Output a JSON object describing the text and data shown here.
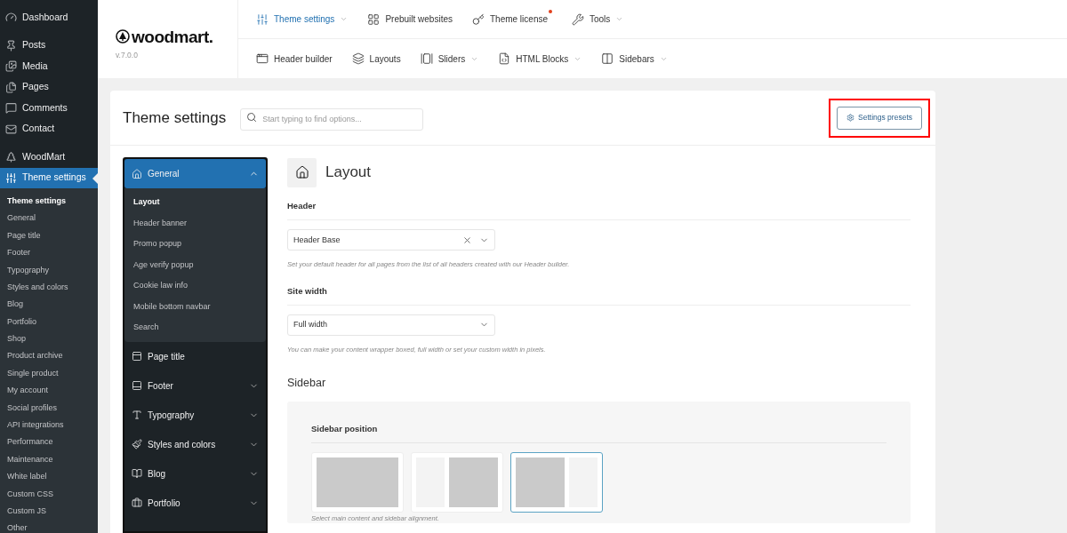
{
  "admin_menu": {
    "groups": [
      [
        {
          "label": "Dashboard",
          "selected": false
        }
      ],
      [
        {
          "label": "Posts",
          "selected": false
        },
        {
          "label": "Media",
          "selected": false
        },
        {
          "label": "Pages",
          "selected": false
        },
        {
          "label": "Comments",
          "selected": false
        },
        {
          "label": "Contact",
          "selected": false
        }
      ],
      [
        {
          "label": "WoodMart",
          "selected": false
        },
        {
          "label": "Theme settings",
          "selected": true
        }
      ]
    ],
    "submenu": [
      {
        "label": "Theme settings",
        "selected": true
      },
      {
        "label": "General",
        "selected": false
      },
      {
        "label": "Page title",
        "selected": false
      },
      {
        "label": "Footer",
        "selected": false
      },
      {
        "label": "Typography",
        "selected": false
      },
      {
        "label": "Styles and colors",
        "selected": false
      },
      {
        "label": "Blog",
        "selected": false
      },
      {
        "label": "Portfolio",
        "selected": false
      },
      {
        "label": "Shop",
        "selected": false
      },
      {
        "label": "Product archive",
        "selected": false
      },
      {
        "label": "Single product",
        "selected": false
      },
      {
        "label": "My account",
        "selected": false
      },
      {
        "label": "Social profiles",
        "selected": false
      },
      {
        "label": "API integrations",
        "selected": false
      },
      {
        "label": "Performance",
        "selected": false
      },
      {
        "label": "Maintenance",
        "selected": false
      },
      {
        "label": "White label",
        "selected": false
      },
      {
        "label": "Custom CSS",
        "selected": false
      },
      {
        "label": "Custom JS",
        "selected": false
      },
      {
        "label": "Other",
        "selected": false
      }
    ]
  },
  "brand": {
    "name": "woodmart.",
    "version": "v.7.0.0"
  },
  "top_nav": [
    [
      {
        "label": "Theme settings",
        "selected": true,
        "has_dropdown": true,
        "notification": false
      },
      {
        "label": "Prebuilt websites",
        "selected": false,
        "has_dropdown": false,
        "notification": false
      },
      {
        "label": "Theme license",
        "selected": false,
        "has_dropdown": false,
        "notification": true
      },
      {
        "label": "Tools",
        "selected": false,
        "has_dropdown": true,
        "notification": false
      }
    ],
    [
      {
        "label": "Header builder",
        "selected": false,
        "has_dropdown": false,
        "notification": false
      },
      {
        "label": "Layouts",
        "selected": false,
        "has_dropdown": false,
        "notification": false
      },
      {
        "label": "Sliders",
        "selected": false,
        "has_dropdown": true,
        "notification": false
      },
      {
        "label": "HTML Blocks",
        "selected": false,
        "has_dropdown": true,
        "notification": false
      },
      {
        "label": "Sidebars",
        "selected": false,
        "has_dropdown": true,
        "notification": false
      }
    ]
  ],
  "page": {
    "title": "Theme settings",
    "search": {
      "placeholder": "Start typing to find options..."
    },
    "presets_button": {
      "label": "Settings presets",
      "highlighted": true
    }
  },
  "sections_nav": [
    {
      "label": "General",
      "expanded": true,
      "expandable": true,
      "children": [
        {
          "label": "Layout",
          "selected": true
        },
        {
          "label": "Header banner",
          "selected": false
        },
        {
          "label": "Promo popup",
          "selected": false
        },
        {
          "label": "Age verify popup",
          "selected": false
        },
        {
          "label": "Cookie law info",
          "selected": false
        },
        {
          "label": "Mobile bottom navbar",
          "selected": false
        },
        {
          "label": "Search",
          "selected": false
        }
      ]
    },
    {
      "label": "Page title",
      "expanded": false,
      "expandable": false
    },
    {
      "label": "Footer",
      "expanded": false,
      "expandable": true
    },
    {
      "label": "Typography",
      "expanded": false,
      "expandable": true
    },
    {
      "label": "Styles and colors",
      "expanded": false,
      "expandable": true
    },
    {
      "label": "Blog",
      "expanded": false,
      "expandable": true
    },
    {
      "label": "Portfolio",
      "expanded": false,
      "expandable": true
    }
  ],
  "content": {
    "title": "Layout",
    "fields": [
      {
        "label": "Header",
        "value": "Header Base",
        "clearable": true,
        "hint": "Set your default header for all pages from the list of all headers created with our Header builder."
      },
      {
        "label": "Site width",
        "value": "Full width",
        "clearable": false,
        "hint": "You can make your content wrapper boxed, full width or set your custom width in pixels."
      }
    ],
    "sidebar": {
      "title": "Sidebar",
      "option_label": "Sidebar position",
      "options": [
        {
          "kind": "none",
          "selected": false
        },
        {
          "kind": "left",
          "selected": false
        },
        {
          "kind": "right",
          "selected": true
        }
      ],
      "hint": "Select main content and sidebar alignment."
    }
  }
}
